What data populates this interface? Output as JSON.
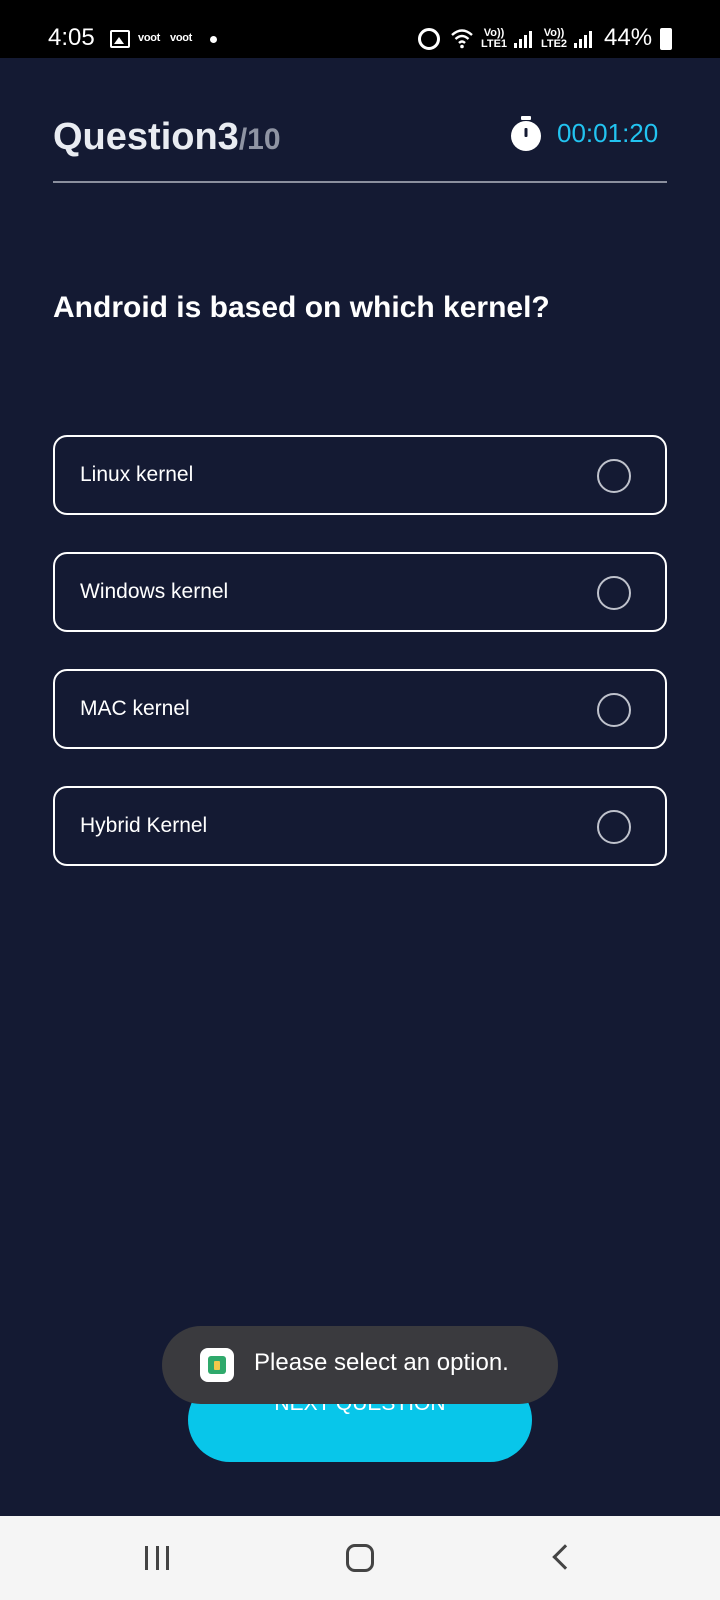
{
  "status_bar": {
    "time": "4:05",
    "app_labels": [
      "voot",
      "voot"
    ],
    "sim1": "Vo)) LTE1",
    "sim2": "Vo)) LTE2",
    "battery": "44%"
  },
  "header": {
    "question_label": "Question3",
    "question_total": "/10",
    "timer": "00:01:20"
  },
  "question": {
    "text": "Android is based on which kernel?"
  },
  "options": [
    {
      "label": "Linux kernel",
      "selected": false
    },
    {
      "label": "Windows kernel",
      "selected": false
    },
    {
      "label": "MAC kernel",
      "selected": false
    },
    {
      "label": "Hybrid Kernel",
      "selected": false
    }
  ],
  "next_button": {
    "label": "NEXT QUESTION"
  },
  "toast": {
    "message": "Please select an option."
  },
  "nav_bar": {
    "icons": [
      "recent-apps-icon",
      "home-icon",
      "back-icon"
    ]
  },
  "colors": {
    "background": "#141a33",
    "accent": "#08c6ea",
    "timer": "#22c3f0"
  }
}
